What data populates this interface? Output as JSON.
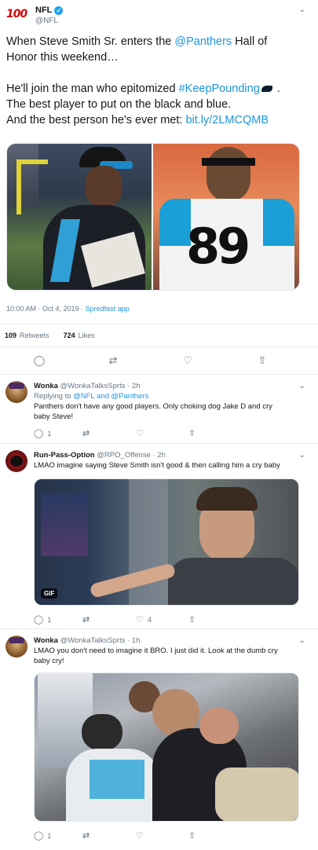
{
  "main_tweet": {
    "author_name": "NFL",
    "author_handle": "@NFL",
    "logo_text": "100",
    "verified_glyph": "✓",
    "caret": "⌄",
    "text": {
      "l1_pre": "When Steve Smith Sr. enters the ",
      "l1_link": "@Panthers",
      "l1_post": " Hall of",
      "l2": "Honor this weekend…",
      "l3_pre": "He'll join the man who epitomized ",
      "l3_link": "#KeepPounding",
      "l3_post": " .",
      "l4": "The best player to put on the black and blue.",
      "l5_pre": "And the best person he's ever met: ",
      "l5_link": "bit.ly/2LMCQMB"
    },
    "timestamp": "10:00 AM · Oct 4, 2019 · ",
    "source": "Spredfast app",
    "retweets_count": "109",
    "retweets_label": "Retweets",
    "likes_count": "724",
    "likes_label": "Likes",
    "icons": {
      "reply": "reply-icon",
      "retweet": "retweet-icon",
      "like": "heart-icon",
      "share": "share-icon"
    }
  },
  "replies": [
    {
      "name": "Wonka",
      "handle_time": "@WonkaTalksSprts · 2h",
      "replying_prefix": "Replying to ",
      "replying_to": "@NFL and @Panthers",
      "text_l1": "Panthers don't have any good players. Only choking dog Jake D and cry",
      "text_l2": "baby Steve!",
      "reply_count": "1",
      "retweet_count": "",
      "like_count": ""
    },
    {
      "name": "Run-Pass-Option",
      "handle_time": "@RPO_Offense · 2h",
      "text_l1": "LMAO imagine saying Steve Smith isn't good & then calling him a cry baby",
      "gif_label": "GIF",
      "reply_count": "1",
      "retweet_count": "",
      "like_count": "4"
    },
    {
      "name": "Wonka",
      "handle_time": "@WonkaTalksSprts · 1h",
      "text_l1": "LMAO you don't need to imagine it BRO. I just did it. Look at the dumb cry",
      "text_l2": "baby cry!",
      "reply_count": "1",
      "retweet_count": "",
      "like_count": ""
    }
  ],
  "glyphs": {
    "reply": "◯",
    "retweet": "⇄",
    "like": "♡",
    "share": "⇧"
  },
  "colors": {
    "link": "#1b95e0",
    "verified": "#1da1f2",
    "muted": "#657786"
  }
}
